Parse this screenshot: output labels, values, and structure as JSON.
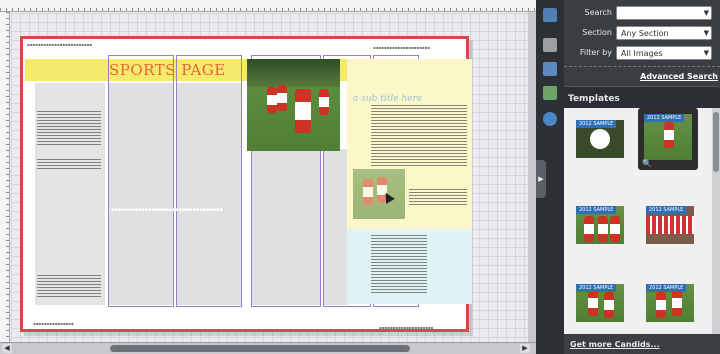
{
  "canvas": {
    "page_title": "SPORTS PAGE",
    "subtitle": "a sub title here",
    "photo_alt": "football player running"
  },
  "panel": {
    "search_label": "Search",
    "search_value": "",
    "section_label": "Section",
    "section_value": "Any Section",
    "filter_label": "Filter by",
    "filter_value": "All Images",
    "advanced_link": "Advanced Search",
    "templates_title": "Templates",
    "more_link": "Get more Candids...",
    "template_badge": "2012 SAMPLE"
  },
  "colors": {
    "page_border": "#d44a4a",
    "title_color": "#e8653a",
    "band_yellow": "#f5ea6a",
    "panel_bg": "#3a3e43"
  }
}
